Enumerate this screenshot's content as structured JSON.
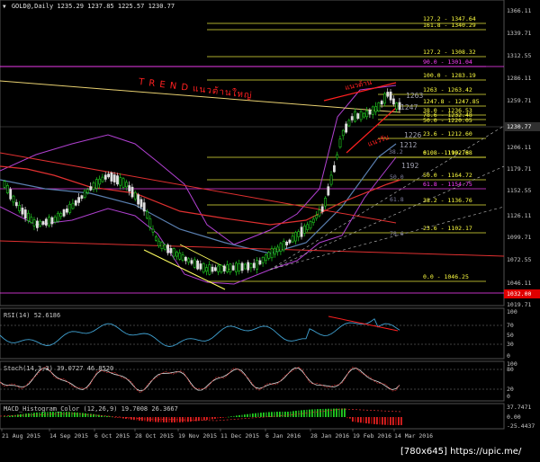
{
  "header": {
    "title": "GOLD@,Daily",
    "ohlc": "1235.29 1237.85 1225.57 1230.77"
  },
  "annotations": {
    "trend_text": "T R E N D แนวต้านใหญ่",
    "triangle_top": "แนวต้าน",
    "triangle_bottom": "แนวรับ",
    "big_labels": [
      "1263",
      "1247",
      "1226",
      "1212",
      "1192"
    ]
  },
  "price_axis": [
    "1366.11",
    "1339.71",
    "1312.55",
    "1286.11",
    "1259.71",
    "1230.77",
    "1206.11",
    "1179.71",
    "1152.55",
    "1126.11",
    "1099.71",
    "1072.55",
    "1046.11",
    "1019.71"
  ],
  "current_price": "1230.77",
  "marker_price": "1032.00",
  "fib_levels": [
    {
      "label": "127.2 - 1347.64",
      "color": "#ffff40"
    },
    {
      "label": "161.8 - 1340.29",
      "color": "#ffff40"
    },
    {
      "label": "127.2 - 1308.32",
      "color": "#ffff40"
    },
    {
      "label": "90.0 - 1301.04",
      "color": "#ff40ff"
    },
    {
      "label": "100.0 - 1283.19",
      "color": "#ffff40"
    },
    {
      "label": "1263 - 1263.42",
      "color": "#ffff40"
    },
    {
      "label": "1247.8 - 1247.85",
      "color": "#ffff40"
    },
    {
      "label": "38.0 - 1236.53",
      "color": "#ffff40"
    },
    {
      "label": "78.6 - 1232.48",
      "color": "#ffff40"
    },
    {
      "label": "50.0 - 1220.05",
      "color": "#ffff40"
    },
    {
      "label": "23.6 - 1212.60",
      "color": "#ffff40"
    },
    {
      "label": "0.0 - 1190.78",
      "color": "#ffff40"
    },
    {
      "label": "61.8 - 1192.68",
      "color": "#ffff40"
    },
    {
      "label": "50.0 - 1164.72",
      "color": "#ffff40"
    },
    {
      "label": "61.8 - 1154.75",
      "color": "#ff40ff"
    },
    {
      "label": "38.2 - 1136.76",
      "color": "#ffff40"
    },
    {
      "label": "23.6 - 1102.17",
      "color": "#ffff40"
    },
    {
      "label": "0.0 - 1046.25",
      "color": "#ffff40"
    }
  ],
  "fan_labels": [
    "38.2",
    "50.0",
    "61.8",
    "78.6"
  ],
  "rsi": {
    "title": "RSI(14) 52.6186",
    "axis": [
      "100",
      "70",
      "50",
      "30",
      "0"
    ]
  },
  "stoch": {
    "title": "Stoch(14,3,3) 39.0727 46.8520",
    "axis": [
      "100",
      "80",
      "20",
      "0"
    ]
  },
  "macd": {
    "title": "MACD_Histogram_Color (12,26,9) 19.7008 26.3667",
    "axis": [
      "37.7471",
      "0.00",
      "-25.4437"
    ]
  },
  "dates": [
    "21 Aug 2015",
    "14 Sep 2015",
    "6 Oct 2015",
    "28 Oct 2015",
    "19 Nov 2015",
    "11 Dec 2015",
    "6 Jan 2016",
    "28 Jan 2016",
    "19 Feb 2016",
    "14 Mar 2016"
  ],
  "footer": "[780x645] https://upic.me/"
}
